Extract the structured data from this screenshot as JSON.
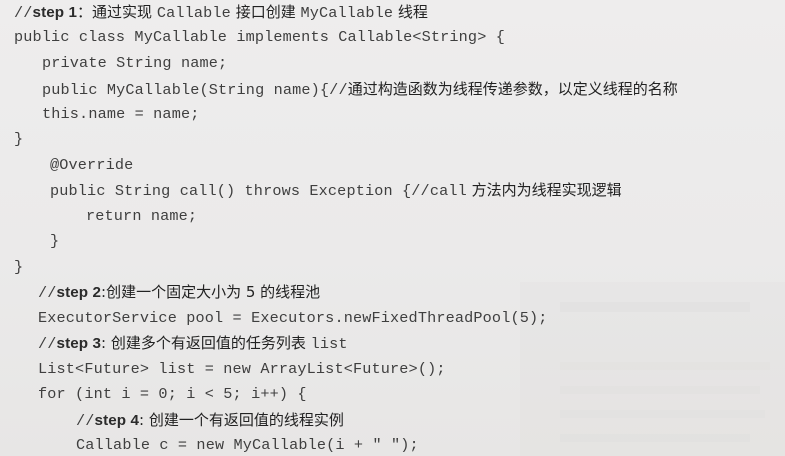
{
  "code": {
    "lines": [
      {
        "parts": [
          {
            "t": "//"
          },
          {
            "t": "step 1",
            "k": "kw"
          },
          {
            "t": "：通过实现 ",
            "k": "cn"
          },
          {
            "t": "Callable"
          },
          {
            "t": " 接口创建 ",
            "k": "cn"
          },
          {
            "t": "MyCallable"
          },
          {
            "t": " 线程",
            "k": "cn"
          }
        ]
      },
      {
        "parts": [
          {
            "t": "public class MyCallable implements Callable<String> {"
          }
        ]
      },
      {
        "parts": [
          {
            "t": "private String name;"
          }
        ]
      },
      {
        "parts": [
          {
            "t": "public MyCallable(String name){//"
          },
          {
            "t": "通过构造函数为线程传递参数，以定义线程的名称",
            "k": "cn"
          }
        ]
      },
      {
        "parts": [
          {
            "t": "this.name = name;"
          }
        ]
      },
      {
        "parts": [
          {
            "t": "}"
          }
        ]
      },
      {
        "parts": [
          {
            "t": "@Override"
          }
        ]
      },
      {
        "parts": [
          {
            "t": "public String call() throws Exception {//call"
          },
          {
            "t": " 方法内为线程实现逻辑",
            "k": "cn"
          }
        ]
      },
      {
        "parts": [
          {
            "t": "return name;"
          }
        ]
      },
      {
        "parts": [
          {
            "t": "}"
          }
        ]
      },
      {
        "parts": [
          {
            "t": "}"
          }
        ]
      },
      {
        "parts": [
          {
            "t": "//"
          },
          {
            "t": "step 2",
            "k": "kw"
          },
          {
            "t": ":创建一个固定大小为 5 的线程池",
            "k": "cn"
          }
        ]
      },
      {
        "parts": [
          {
            "t": "ExecutorService pool = Executors.newFixedThreadPool(5);"
          }
        ]
      },
      {
        "parts": [
          {
            "t": "//"
          },
          {
            "t": "step 3",
            "k": "kw"
          },
          {
            "t": ": 创建多个有返回值的任务列表 ",
            "k": "cn"
          },
          {
            "t": "list"
          }
        ]
      },
      {
        "parts": [
          {
            "t": "List<Future> list = new ArrayList<Future>();"
          }
        ]
      },
      {
        "parts": [
          {
            "t": "for (int i = 0; i < 5; i++) {"
          }
        ]
      },
      {
        "parts": [
          {
            "t": "//"
          },
          {
            "t": "step 4",
            "k": "kw"
          },
          {
            "t": ": 创建一个有返回值的线程实例",
            "k": "cn"
          }
        ]
      },
      {
        "parts": [
          {
            "t": "Callable c = new MyCallable(i + \" \");"
          }
        ]
      }
    ]
  }
}
